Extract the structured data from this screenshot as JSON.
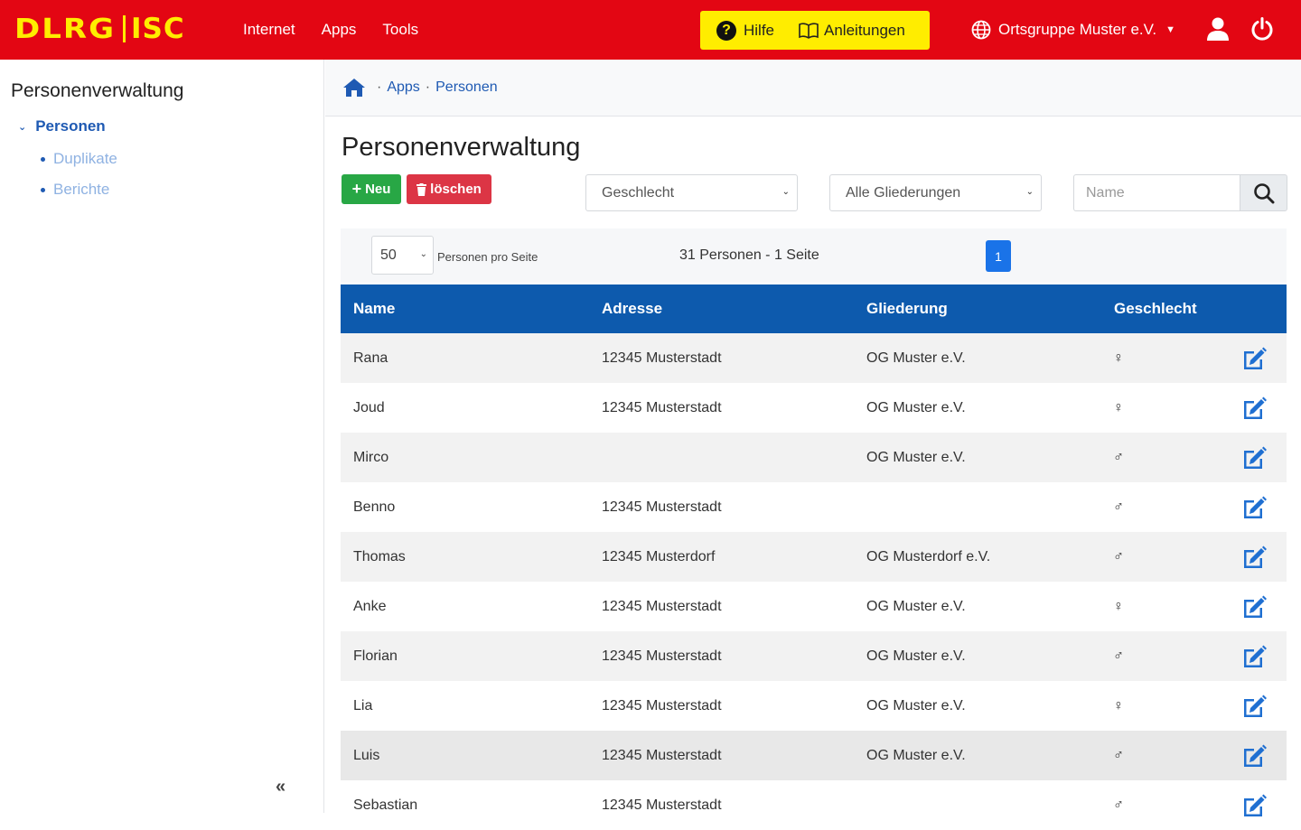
{
  "topbar": {
    "logo_left": "DLRG",
    "logo_right": "ISC",
    "nav": [
      "Internet",
      "Apps",
      "Tools"
    ],
    "help_label": "Hilfe",
    "guides_label": "Anleitungen",
    "org_label": "Ortsgruppe Muster e.V.",
    "colors": {
      "bar": "#e30613",
      "accent": "#ffed00"
    }
  },
  "sidebar": {
    "title": "Personenverwaltung",
    "active_item": "Personen",
    "sub_items": [
      "Duplikate",
      "Berichte"
    ],
    "collapse_label": "«"
  },
  "breadcrumb": {
    "items": [
      "Apps",
      "Personen"
    ]
  },
  "main": {
    "title": "Personenverwaltung",
    "new_label": "Neu",
    "delete_label": "löschen",
    "filter_gender_placeholder": "Geschlecht",
    "filter_division_placeholder": "Alle Gliederungen",
    "search_placeholder": "Name"
  },
  "pagination": {
    "per_page": "50",
    "per_page_label": "Personen pro Seite",
    "summary": "31 Personen - 1 Seite",
    "current_page": "1"
  },
  "table": {
    "headers": [
      "Name",
      "Adresse",
      "Gliederung",
      "Geschlecht"
    ],
    "rows": [
      {
        "name": "Rana",
        "address": "12345 Musterstadt",
        "division": "OG Muster e.V.",
        "sex": "♀"
      },
      {
        "name": "Joud",
        "address": "12345 Musterstadt",
        "division": "OG Muster e.V.",
        "sex": "♀"
      },
      {
        "name": "Mirco",
        "address": "",
        "division": "OG Muster e.V.",
        "sex": "♂"
      },
      {
        "name": "Benno",
        "address": "12345 Musterstadt",
        "division": "",
        "sex": "♂"
      },
      {
        "name": "Thomas",
        "address": "12345 Musterdorf",
        "division": "OG Musterdorf e.V.",
        "sex": "♂"
      },
      {
        "name": "Anke",
        "address": "12345 Musterstadt",
        "division": "OG Muster e.V.",
        "sex": "♀"
      },
      {
        "name": "Florian",
        "address": "12345 Musterstadt",
        "division": "OG Muster e.V.",
        "sex": "♂"
      },
      {
        "name": "Lia",
        "address": "12345 Musterstadt",
        "division": "OG Muster e.V.",
        "sex": "♀"
      },
      {
        "name": "Luis",
        "address": "12345 Musterstadt",
        "division": "OG Muster e.V.",
        "sex": "♂"
      },
      {
        "name": "Sebastian",
        "address": "12345 Musterstadt",
        "division": "",
        "sex": "♂"
      }
    ]
  }
}
